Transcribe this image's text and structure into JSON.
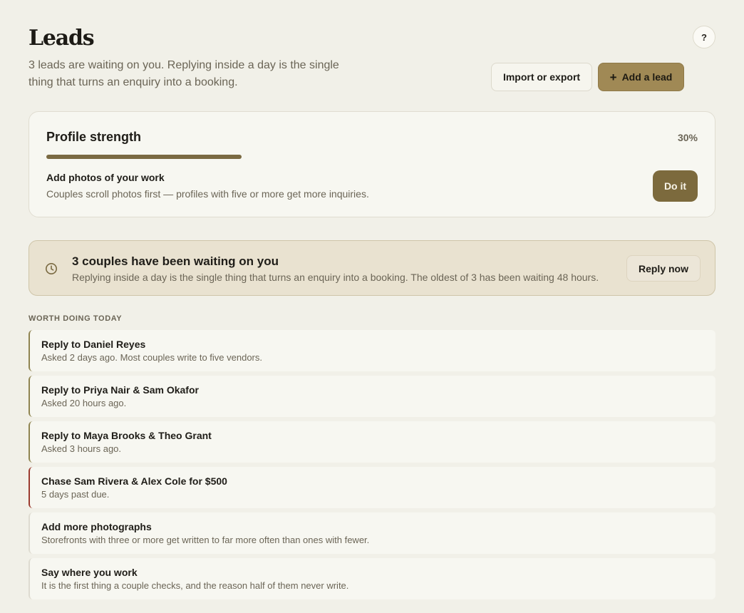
{
  "header": {
    "title": "Leads",
    "subtitle": "3 leads are waiting on you. Replying inside a day is the single thing that turns an enquiry into a booking.",
    "help_label": "?",
    "import_label": "Import or export",
    "add_icon": "plus-icon",
    "add_label": "Add a lead"
  },
  "profile": {
    "title": "Profile strength",
    "percent_label": "30%",
    "progress": 0.3,
    "tip_title": "Add photos of your work",
    "tip_desc": "Couples scroll photos first — profiles with five or more get more inquiries.",
    "action_label": "Do it"
  },
  "alert": {
    "icon": "clock-icon",
    "title": "3 couples have been waiting on you",
    "desc": "Replying inside a day is the single thing that turns an enquiry into a booking. The oldest of 3 has been waiting 48 hours.",
    "action_label": "Reply now"
  },
  "today": {
    "section_label": "WORTH DOING TODAY",
    "tasks": [
      {
        "title": "Reply to Daniel Reyes",
        "desc": "Asked 2 days ago. Most couples write to five vendors."
      },
      {
        "title": "Reply to Priya Nair & Sam Okafor",
        "desc": "Asked 20 hours ago."
      },
      {
        "title": "Reply to Maya Brooks & Theo Grant",
        "desc": "Asked 3 hours ago."
      },
      {
        "title": "Chase Sam Rivera & Alex Cole for $500",
        "desc": "5 days past due."
      },
      {
        "title": "Add more photographs",
        "desc": "Storefronts with three or more get written to far more often than ones with fewer."
      },
      {
        "title": "Say where you work",
        "desc": "It is the first thing a couple checks, and the reason half of them never write."
      }
    ]
  },
  "colors": {
    "accent": "#a08955",
    "accent_dark": "#7c6a3d",
    "overdue": "#9b3a2e",
    "background": "#f1f0e8"
  }
}
